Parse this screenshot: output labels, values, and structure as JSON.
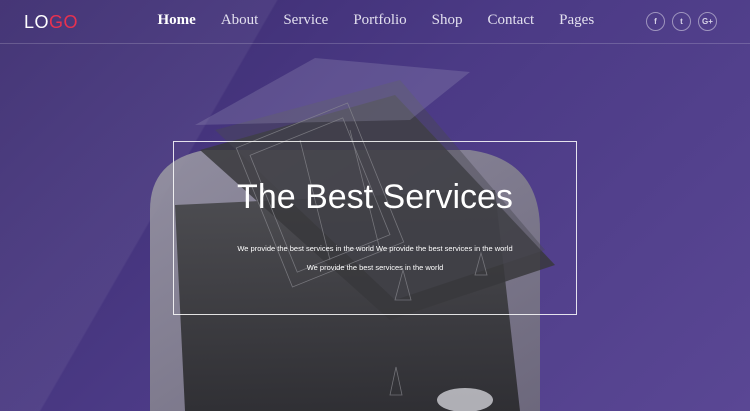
{
  "header": {
    "logo_part1": "LO",
    "logo_part2": "GO",
    "nav": [
      {
        "label": "Home"
      },
      {
        "label": "About"
      },
      {
        "label": "Service"
      },
      {
        "label": "Portfolio"
      },
      {
        "label": "Shop"
      },
      {
        "label": "Contact"
      },
      {
        "label": "Pages"
      }
    ],
    "social": [
      {
        "icon": "facebook-icon",
        "glyph": "f"
      },
      {
        "icon": "twitter-icon",
        "glyph": "t"
      },
      {
        "icon": "google-plus-icon",
        "glyph": "G+"
      }
    ]
  },
  "hero": {
    "title": "The Best Services",
    "subtitle_line1": "We provide the best services in the world We provide the best services in the world",
    "subtitle_line2": "We provide the best services in the world"
  },
  "colors": {
    "background": "#4b3a85",
    "logo_accent": "#e8314f",
    "text": "#ffffff"
  }
}
